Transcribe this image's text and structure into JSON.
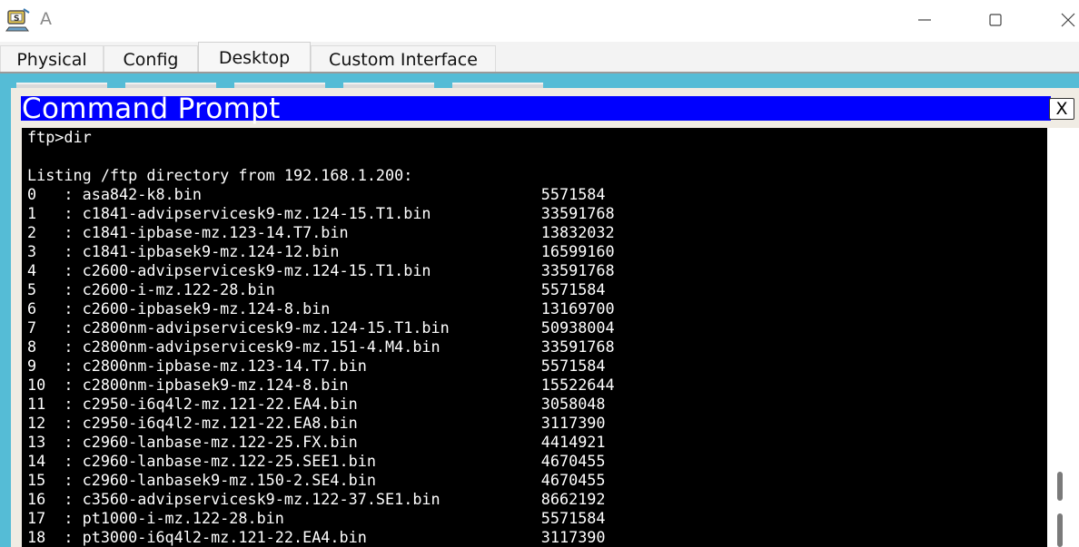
{
  "window": {
    "title": "A",
    "icon": "packet-tracer-pc-icon",
    "controls": [
      "minimize-icon",
      "maximize-icon",
      "close-icon"
    ]
  },
  "tabs": [
    {
      "label": "Physical",
      "active": false
    },
    {
      "label": "Config",
      "active": false
    },
    {
      "label": "Desktop",
      "active": true
    },
    {
      "label": "Custom Interface",
      "active": false
    }
  ],
  "command_prompt": {
    "title": "Command Prompt",
    "close_label": "X",
    "title_color": "#0000ff",
    "prompt_line": "ftp>dir",
    "listing_header": "Listing /ftp directory from 192.168.1.200:",
    "files": [
      {
        "index": "0",
        "name": "asa842-k8.bin",
        "size": "5571584"
      },
      {
        "index": "1",
        "name": "c1841-advipservicesk9-mz.124-15.T1.bin",
        "size": "33591768"
      },
      {
        "index": "2",
        "name": "c1841-ipbase-mz.123-14.T7.bin",
        "size": "13832032"
      },
      {
        "index": "3",
        "name": "c1841-ipbasek9-mz.124-12.bin",
        "size": "16599160"
      },
      {
        "index": "4",
        "name": "c2600-advipservicesk9-mz.124-15.T1.bin",
        "size": "33591768"
      },
      {
        "index": "5",
        "name": "c2600-i-mz.122-28.bin",
        "size": "5571584"
      },
      {
        "index": "6",
        "name": "c2600-ipbasek9-mz.124-8.bin",
        "size": "13169700"
      },
      {
        "index": "7",
        "name": "c2800nm-advipservicesk9-mz.124-15.T1.bin",
        "size": "50938004"
      },
      {
        "index": "8",
        "name": "c2800nm-advipservicesk9-mz.151-4.M4.bin",
        "size": "33591768"
      },
      {
        "index": "9",
        "name": "c2800nm-ipbase-mz.123-14.T7.bin",
        "size": "5571584"
      },
      {
        "index": "10",
        "name": "c2800nm-ipbasek9-mz.124-8.bin",
        "size": "15522644"
      },
      {
        "index": "11",
        "name": "c2950-i6q4l2-mz.121-22.EA4.bin",
        "size": "3058048"
      },
      {
        "index": "12",
        "name": "c2950-i6q4l2-mz.121-22.EA8.bin",
        "size": "3117390"
      },
      {
        "index": "13",
        "name": "c2960-lanbase-mz.122-25.FX.bin",
        "size": "4414921"
      },
      {
        "index": "14",
        "name": "c2960-lanbase-mz.122-25.SEE1.bin",
        "size": "4670455"
      },
      {
        "index": "15",
        "name": "c2960-lanbasek9-mz.150-2.SE4.bin",
        "size": "4670455"
      },
      {
        "index": "16",
        "name": "c3560-advipservicesk9-mz.122-37.SE1.bin",
        "size": "8662192"
      },
      {
        "index": "17",
        "name": "pt1000-i-mz.122-28.bin",
        "size": "5571584"
      },
      {
        "index": "18",
        "name": "pt3000-i6q4l2-mz.121-22.EA4.bin",
        "size": "3117390"
      }
    ]
  }
}
